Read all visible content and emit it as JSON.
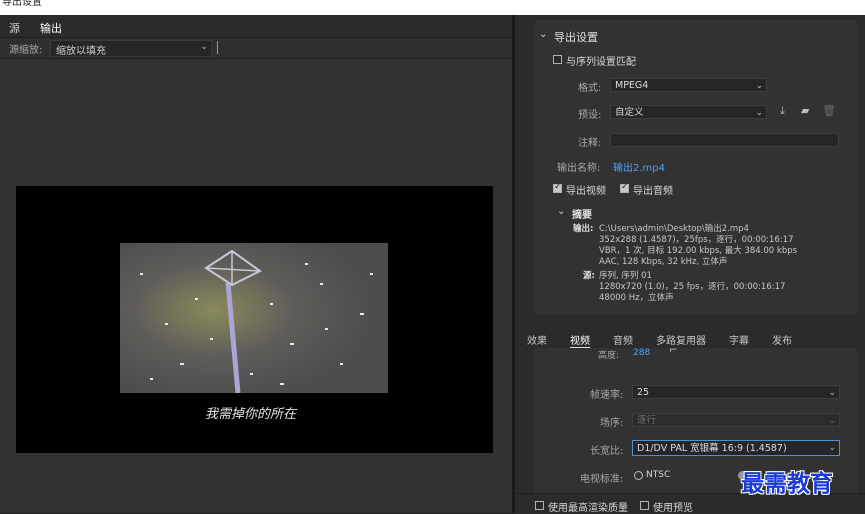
{
  "window": {
    "title": "导出设置"
  },
  "left": {
    "tabs": [
      "源",
      "输出"
    ],
    "scale_label": "源缩放:",
    "scale_value": "缩放以填充",
    "subtitle": "我需掉你的所在"
  },
  "export": {
    "section_title": "导出设置",
    "match_sequence": "与序列设置匹配",
    "format_label": "格式:",
    "format_value": "MPEG4",
    "preset_label": "预设:",
    "preset_value": "自定义",
    "comment_label": "注释:",
    "comment_value": "",
    "output_name_label": "输出名称:",
    "output_name_value": "输出2.mp4",
    "export_video": "导出视频",
    "export_audio": "导出音频",
    "summary_title": "摘要",
    "output_label": "输出:",
    "output_lines": [
      "C:\\Users\\admin\\Desktop\\输出2.mp4",
      "352x288 (1.4587)，25fps，逐行，00:00:16:17",
      "VBR，1 次, 目标 192.00 kbps, 最大 384.00 kbps",
      "AAC, 128 Kbps, 32  kHz, 立体声"
    ],
    "source_label": "源:",
    "source_lines": [
      "序列, 序列 01",
      "1280x720  (1.0)，25 fps，逐行，00:00:16:17",
      "48000 Hz，立体声"
    ]
  },
  "lower_tabs": [
    "效果",
    "视频",
    "音频",
    "多路复用器",
    "字幕",
    "发布"
  ],
  "video": {
    "height_label": "高度:",
    "height_value": "288",
    "framerate_label": "帧速率:",
    "framerate_value": "25",
    "field_label": "场序:",
    "field_value": "逐行",
    "aspect_label": "长宽比:",
    "aspect_value": "D1/DV PAL 宽银幕 16:9 (1.4587)",
    "tv_label": "电视标准:",
    "tv_value": "NTSC"
  },
  "bottom": {
    "max_quality": "使用最高渲染质量",
    "use_preview": "使用预览"
  },
  "watermark": "最需教育"
}
